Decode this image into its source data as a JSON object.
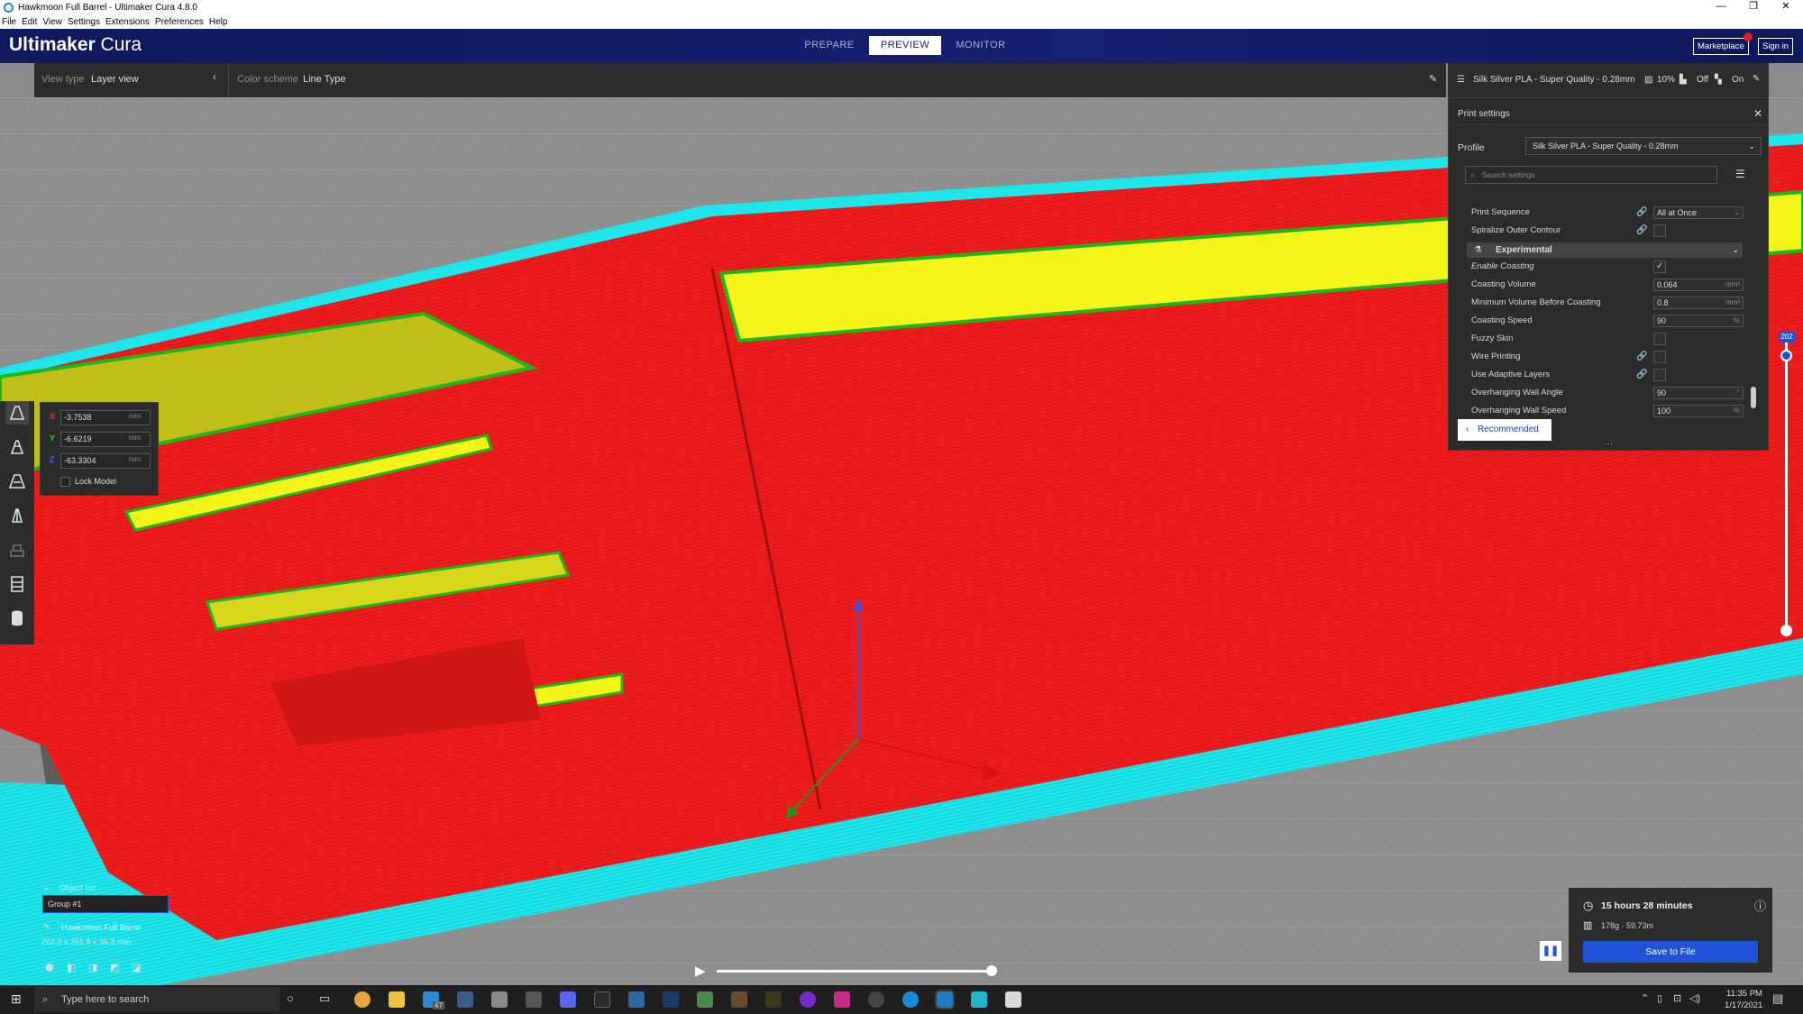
{
  "window": {
    "title": "Hawkmoon Full Barrel - Ultimaker Cura 4.8.0"
  },
  "menu": [
    "File",
    "Edit",
    "View",
    "Settings",
    "Extensions",
    "Preferences",
    "Help"
  ],
  "header": {
    "logo_bold": "Ultimaker",
    "logo_light": " Cura",
    "tabs": [
      {
        "label": "PREPARE",
        "active": false
      },
      {
        "label": "PREVIEW",
        "active": true
      },
      {
        "label": "MONITOR",
        "active": false
      }
    ],
    "marketplace_label": "Marketplace",
    "signin_label": "Sign in"
  },
  "toolbar": {
    "view_type_label": "View type",
    "view_type_value": "Layer view",
    "color_scheme_label": "Color scheme",
    "color_scheme_value": "Line Type",
    "profile_summary": "Silk Silver PLA - Super Quality - 0.28mm",
    "infill": "10%",
    "support": "Off",
    "adhesion": "On"
  },
  "move_panel": {
    "x": "-3.7538",
    "y": "-6.6219",
    "z": "-63.3304",
    "unit": "mm",
    "lock_label": "Lock Model"
  },
  "print_settings": {
    "title": "Print settings",
    "profile_label": "Profile",
    "profile_value": "Silk Silver PLA - Super Quality - 0.28mm",
    "search_placeholder": "Search settings",
    "category": "Experimental",
    "rows": [
      {
        "label": "Print Sequence",
        "value": "All at Once",
        "type": "select"
      },
      {
        "label": "Spiralize Outer Contour",
        "value": "",
        "type": "checkbox"
      },
      {
        "label": "Enable Coasting",
        "value": "✓",
        "type": "checkbox"
      },
      {
        "label": "Coasting Volume",
        "value": "0.064",
        "unit": "mm³",
        "type": "field"
      },
      {
        "label": "Minimum Volume Before Coasting",
        "value": "0.8",
        "unit": "mm³",
        "type": "field"
      },
      {
        "label": "Coasting Speed",
        "value": "90",
        "unit": "%",
        "type": "field"
      },
      {
        "label": "Fuzzy Skin",
        "value": "",
        "type": "checkbox"
      },
      {
        "label": "Wire Printing",
        "value": "",
        "type": "checkbox"
      },
      {
        "label": "Use Adaptive Layers",
        "value": "",
        "type": "checkbox"
      },
      {
        "label": "Overhanging Wall Angle",
        "value": "90",
        "unit": "°",
        "type": "field"
      },
      {
        "label": "Overhanging Wall Speed",
        "value": "100",
        "unit": "%",
        "type": "field"
      }
    ],
    "recommended_label": "Recommended"
  },
  "layer_slider": {
    "value": "202"
  },
  "object_list": {
    "header": "Object list",
    "group": "Group #1",
    "object_name": "Hawkmoon Full Barrel",
    "dimensions": "262.0 x 261.8 x 36.3 mm"
  },
  "estimate": {
    "time": "15 hours 28 minutes",
    "material": "178g · 59.73m",
    "save_label": "Save to File"
  },
  "taskbar": {
    "search_placeholder": "Type here to search",
    "time": "11:35 PM",
    "date": "1/17/2021",
    "mail_badge": "47"
  }
}
